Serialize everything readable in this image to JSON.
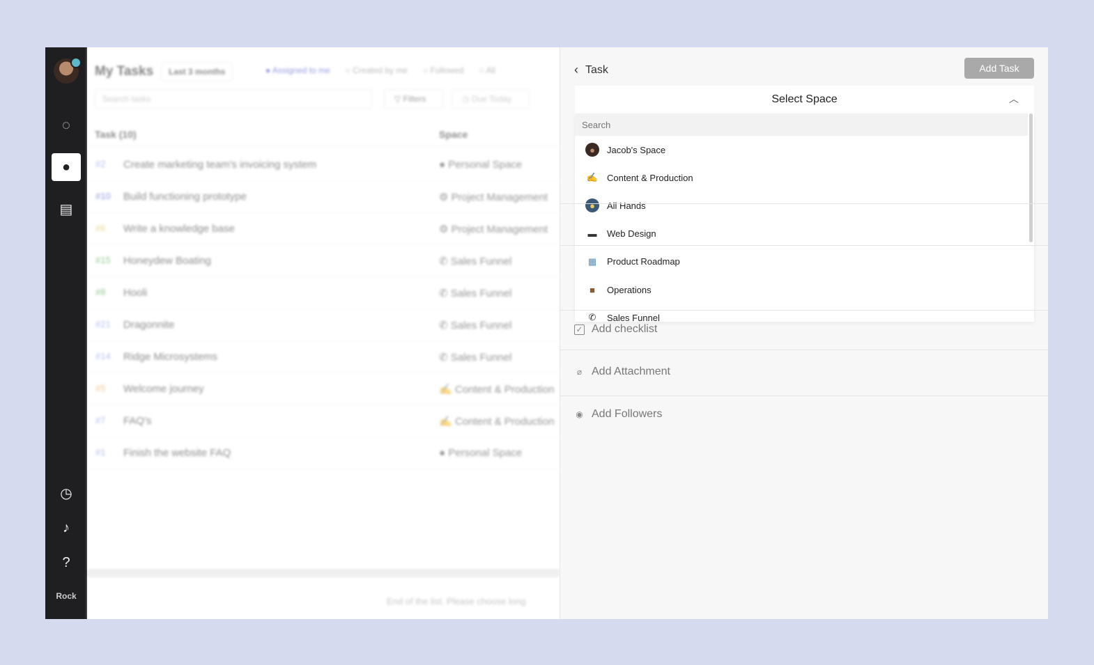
{
  "rail": {
    "brand_label": "Rock"
  },
  "list": {
    "title": "My Tasks",
    "range": "Last 3 months",
    "filters": [
      "Assigned to me",
      "Created by me",
      "Followed",
      "All"
    ],
    "search_placeholder": "Search tasks",
    "filters_btn": "Filters",
    "due_btn": "Due Today",
    "col_task": "Task (10)",
    "col_space": "Space",
    "rows": [
      {
        "num": "#2",
        "name": "Create marketing team's invoicing system",
        "space": "Personal Space",
        "color": "#7b8ce8"
      },
      {
        "num": "#10",
        "name": "Build functioning prototype",
        "space": "Project Management",
        "color": "#3c49c9"
      },
      {
        "num": "#6",
        "name": "Write a knowledge base",
        "space": "Project Management",
        "color": "#d6c13a"
      },
      {
        "num": "#15",
        "name": "Honeydew Boating",
        "space": "Sales Funnel",
        "color": "#3aa13a"
      },
      {
        "num": "#8",
        "name": "Hooli",
        "space": "Sales Funnel",
        "color": "#3aa13a"
      },
      {
        "num": "#21",
        "name": "Dragonnite",
        "space": "Sales Funnel",
        "color": "#7b8ce8"
      },
      {
        "num": "#14",
        "name": "Ridge Microsystems",
        "space": "Sales Funnel",
        "color": "#7b8ce8"
      },
      {
        "num": "#5",
        "name": "Welcome journey",
        "space": "Content & Production",
        "color": "#e8a23a"
      },
      {
        "num": "#7",
        "name": "FAQ's",
        "space": "Content & Production",
        "color": "#7b8ce8"
      },
      {
        "num": "#1",
        "name": "Finish the website FAQ",
        "space": "Personal Space",
        "color": "#7b8ce8"
      }
    ],
    "footer": "End of the list. Please choose long"
  },
  "panel": {
    "back_label": "Task",
    "add_task": "Add Task",
    "select_space": "Select Space",
    "dropdown": {
      "search_placeholder": "Search",
      "items": [
        {
          "label": "Jacob's Space",
          "icon": "person-avatar"
        },
        {
          "label": "Content & Production",
          "icon": "writing-hand"
        },
        {
          "label": "All Hands",
          "icon": "group-avatar"
        },
        {
          "label": "Web Design",
          "icon": "desktop-computer"
        },
        {
          "label": "Product Roadmap",
          "icon": "map"
        },
        {
          "label": "Operations",
          "icon": "briefcase"
        },
        {
          "label": "Sales Funnel",
          "icon": "telephone"
        }
      ]
    },
    "add_checklist": "Add checklist",
    "add_attachment": "Add Attachment",
    "add_followers": "Add Followers"
  }
}
